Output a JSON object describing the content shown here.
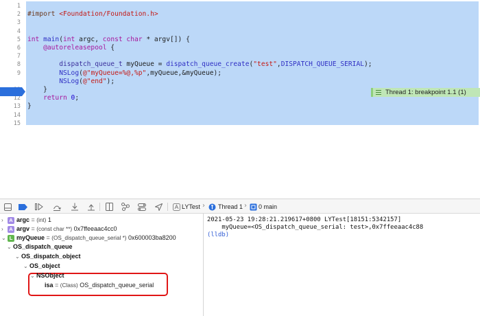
{
  "editor": {
    "line_numbers": [
      "1",
      "2",
      "3",
      "4",
      "5",
      "6",
      "7",
      "8",
      "9",
      "10",
      "11",
      "12",
      "13",
      "14",
      "15"
    ],
    "current_line": "10",
    "lines": [
      [],
      [
        {
          "t": "#import ",
          "c": "mac"
        },
        {
          "t": "<Foundation/Foundation.h>",
          "c": "str"
        }
      ],
      [],
      [],
      [
        {
          "t": "int ",
          "c": "kw"
        },
        {
          "t": "main",
          "c": "fn"
        },
        {
          "t": "(",
          "c": ""
        },
        {
          "t": "int ",
          "c": "kw"
        },
        {
          "t": "argc, ",
          "c": ""
        },
        {
          "t": "const ",
          "c": "kw"
        },
        {
          "t": "char ",
          "c": "kw"
        },
        {
          "t": "* argv[]) {",
          "c": ""
        }
      ],
      [
        {
          "t": "    ",
          "c": ""
        },
        {
          "t": "@autoreleasepool",
          "c": "kw"
        },
        {
          "t": " {",
          "c": ""
        }
      ],
      [],
      [
        {
          "t": "        ",
          "c": ""
        },
        {
          "t": "dispatch_queue_t",
          "c": "tp"
        },
        {
          "t": " myQueue = ",
          "c": ""
        },
        {
          "t": "dispatch_queue_create",
          "c": "fn"
        },
        {
          "t": "(",
          "c": ""
        },
        {
          "t": "\"test\"",
          "c": "str"
        },
        {
          "t": ",",
          "c": ""
        },
        {
          "t": "DISPATCH_QUEUE_SERIAL",
          "c": "fn"
        },
        {
          "t": ");",
          "c": ""
        }
      ],
      [
        {
          "t": "        ",
          "c": ""
        },
        {
          "t": "NSLog",
          "c": "fn"
        },
        {
          "t": "(",
          "c": ""
        },
        {
          "t": "@\"myQueue=%@,%p\"",
          "c": "str"
        },
        {
          "t": ",myQueue,&myQueue);",
          "c": ""
        }
      ],
      [
        {
          "t": "        ",
          "c": ""
        },
        {
          "t": "NSLog",
          "c": "fn"
        },
        {
          "t": "(",
          "c": ""
        },
        {
          "t": "@\"end\"",
          "c": "str"
        },
        {
          "t": ");",
          "c": ""
        }
      ],
      [
        {
          "t": "    }",
          "c": ""
        }
      ],
      [
        {
          "t": "    ",
          "c": ""
        },
        {
          "t": "return ",
          "c": "kw"
        },
        {
          "t": "0",
          "c": "num"
        },
        {
          "t": ";",
          "c": ""
        }
      ],
      [
        {
          "t": "}",
          "c": ""
        }
      ],
      [],
      []
    ],
    "thread_badge": "Thread 1: breakpoint 1.1 (1)"
  },
  "debug_toolbar": {
    "breadcrumb": {
      "app": "LYTest",
      "thread": "Thread 1",
      "frame": "0 main"
    }
  },
  "variables": {
    "rows": [
      {
        "chev": "›",
        "badge": "A",
        "name": "argc",
        "type": "(int)",
        "value": "1"
      },
      {
        "chev": "›",
        "badge": "A",
        "name": "argv",
        "type": "(const char **)",
        "value": "0x7ffeeaac4cc0"
      },
      {
        "chev": "⌄",
        "badge": "L",
        "name": "myQueue",
        "type": "(OS_dispatch_queue_serial *)",
        "value": "0x600003ba8200"
      },
      {
        "chev": "⌄",
        "badge": "",
        "name": "OS_dispatch_queue",
        "type": "",
        "value": ""
      },
      {
        "chev": "⌄",
        "badge": "",
        "name": "OS_dispatch_object",
        "type": "",
        "value": ""
      },
      {
        "chev": "⌄",
        "badge": "",
        "name": "OS_object",
        "type": "",
        "value": ""
      },
      {
        "chev": "⌄",
        "badge": "",
        "name": "NSObject",
        "type": "",
        "value": ""
      },
      {
        "chev": "",
        "badge": "",
        "name": "isa",
        "type": "(Class)",
        "value": "OS_dispatch_queue_serial"
      }
    ]
  },
  "console": {
    "lines": [
      "2021-05-23 19:28:21.219617+0800 LYTest[18151:5342157]",
      "    myQueue=<OS_dispatch_queue_serial: test>,0x7ffeeaac4c88"
    ],
    "prompt": "(lldb)"
  }
}
